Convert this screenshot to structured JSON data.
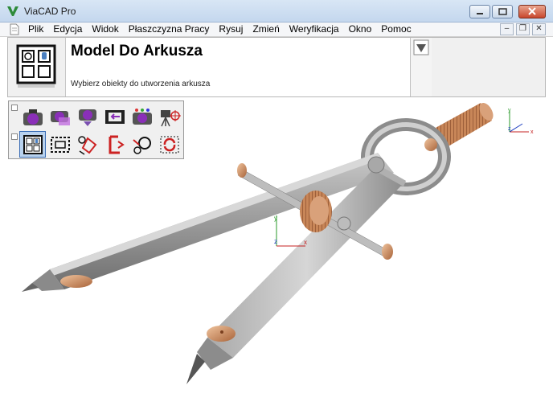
{
  "window": {
    "title": "ViaCAD Pro"
  },
  "menu": {
    "items": [
      "Plik",
      "Edycja",
      "Widok",
      "Płaszczyzna Pracy",
      "Rysuj",
      "Zmień",
      "Weryfikacja",
      "Okno",
      "Pomoc"
    ]
  },
  "header": {
    "title": "Model Do Arkusza",
    "subtitle": "Wybierz obiekty do utworzenia arkusza"
  },
  "toolbar": {
    "row1": [
      "camera-purple-icon",
      "camera-stack-icon",
      "camera-down-icon",
      "film-import-icon",
      "camera-alt-icon",
      "tripod-target-icon"
    ],
    "row2": [
      "model-to-sheet-icon",
      "rectangle-select-icon",
      "rotate-shape-icon",
      "trim-bracket-icon",
      "circle-arrow-icon",
      "refresh-icon"
    ],
    "active_index": 0
  },
  "viewport": {
    "axis_labels": {
      "x": "x",
      "y": "y",
      "z": "z"
    }
  },
  "colors": {
    "accent": "#3a6db5",
    "metal": "#9a9a9a",
    "brass": "#c8875a"
  }
}
